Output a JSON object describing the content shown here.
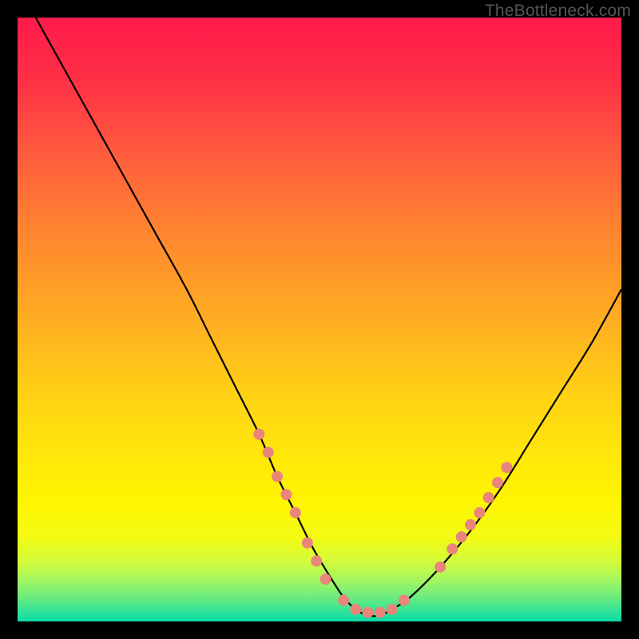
{
  "watermark": "TheBottleneck.com",
  "gradient": {
    "stops": [
      {
        "offset": 0.0,
        "color": "#ff1a4b"
      },
      {
        "offset": 0.1,
        "color": "#ff2f46"
      },
      {
        "offset": 0.22,
        "color": "#ff5a3e"
      },
      {
        "offset": 0.35,
        "color": "#ff8330"
      },
      {
        "offset": 0.5,
        "color": "#ffad22"
      },
      {
        "offset": 0.62,
        "color": "#ffd015"
      },
      {
        "offset": 0.72,
        "color": "#ffe60a"
      },
      {
        "offset": 0.8,
        "color": "#fff500"
      },
      {
        "offset": 0.86,
        "color": "#f3fb12"
      },
      {
        "offset": 0.9,
        "color": "#d4fb3a"
      },
      {
        "offset": 0.93,
        "color": "#a7f65f"
      },
      {
        "offset": 0.96,
        "color": "#6bec7e"
      },
      {
        "offset": 0.985,
        "color": "#2be39a"
      },
      {
        "offset": 1.0,
        "color": "#08dca8"
      }
    ]
  },
  "chart_data": {
    "type": "line",
    "title": "",
    "xlabel": "",
    "ylabel": "",
    "xlim": [
      0,
      100
    ],
    "ylim": [
      0,
      100
    ],
    "series": [
      {
        "name": "bottleneck-curve",
        "x": [
          3,
          8,
          13,
          18,
          23,
          28,
          32,
          36,
          40,
          43,
          46,
          49,
          52,
          54,
          56,
          58,
          60,
          62,
          65,
          70,
          75,
          80,
          85,
          90,
          95,
          100
        ],
        "y": [
          100,
          91,
          82,
          73,
          64,
          55,
          47,
          39,
          31,
          24,
          18,
          12,
          7,
          4,
          2,
          1,
          1,
          2,
          4,
          9,
          15,
          22,
          30,
          38,
          46,
          55
        ]
      }
    ],
    "markers": {
      "name": "highlight-dots",
      "color": "#e9857b",
      "radius": 7,
      "points": [
        {
          "x": 40,
          "y": 31
        },
        {
          "x": 41.5,
          "y": 28
        },
        {
          "x": 43,
          "y": 24
        },
        {
          "x": 44.5,
          "y": 21
        },
        {
          "x": 46,
          "y": 18
        },
        {
          "x": 48,
          "y": 13
        },
        {
          "x": 49.5,
          "y": 10
        },
        {
          "x": 51,
          "y": 7
        },
        {
          "x": 54,
          "y": 3.5
        },
        {
          "x": 56,
          "y": 2
        },
        {
          "x": 58,
          "y": 1.5
        },
        {
          "x": 60,
          "y": 1.5
        },
        {
          "x": 62,
          "y": 2
        },
        {
          "x": 64,
          "y": 3.5
        },
        {
          "x": 70,
          "y": 9
        },
        {
          "x": 72,
          "y": 12
        },
        {
          "x": 73.5,
          "y": 14
        },
        {
          "x": 75,
          "y": 16
        },
        {
          "x": 76.5,
          "y": 18
        },
        {
          "x": 78,
          "y": 20.5
        },
        {
          "x": 79.5,
          "y": 23
        },
        {
          "x": 81,
          "y": 25.5
        }
      ]
    }
  }
}
